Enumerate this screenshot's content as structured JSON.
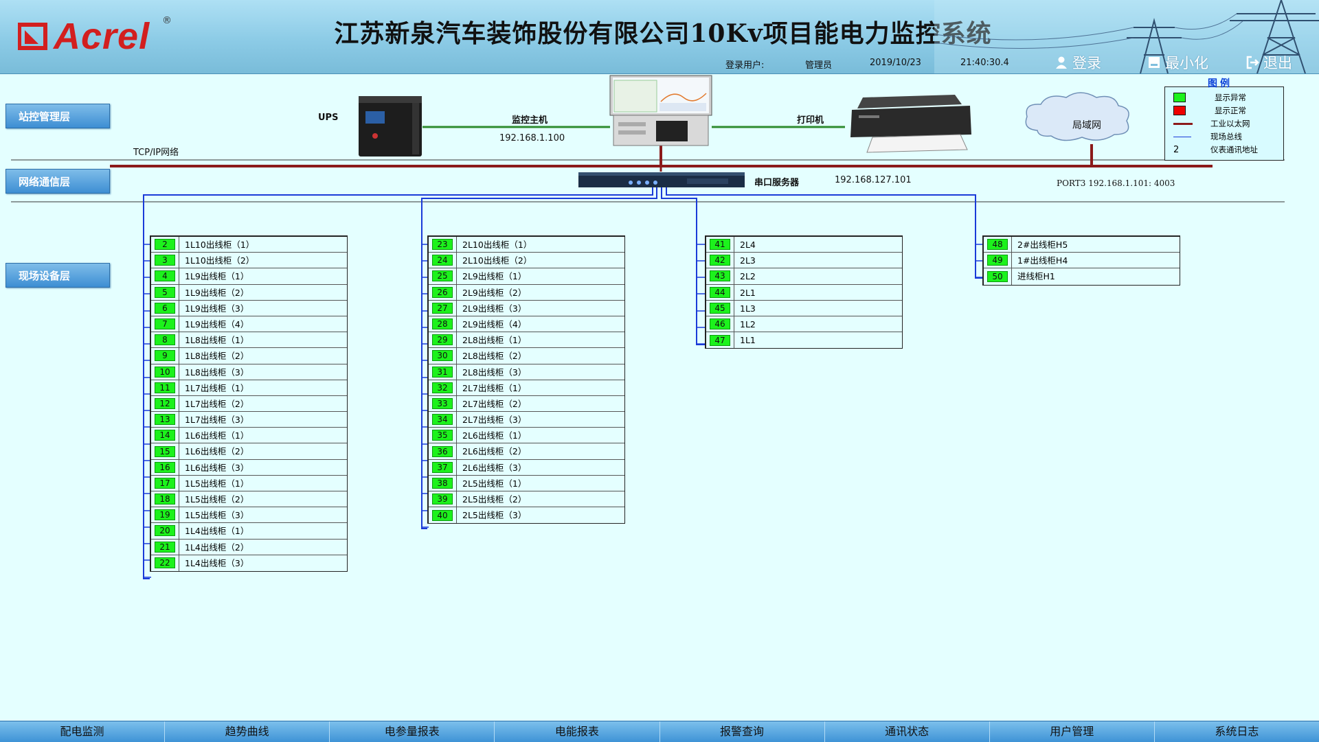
{
  "header": {
    "brand": "Acrel",
    "title": "江苏新泉汽车装饰股份有限公司10Kv项目能电力监控系统",
    "login_label": "登录用户:",
    "user": "管理员",
    "date": "2019/10/23",
    "time": "21:40:30.4",
    "btn_login": "登录",
    "btn_minimize": "最小化",
    "btn_exit": "退出"
  },
  "layers": {
    "station": "站控管理层",
    "network": "网络通信层",
    "field": "现场设备层"
  },
  "topology": {
    "ups": "UPS",
    "host": "监控主机",
    "host_ip": "192.168.1.100",
    "printer": "打印机",
    "lan": "局域网",
    "tcpip": "TCP/IP网络",
    "serial_server": "串口服务器",
    "serial_ip": "192.168.127.101",
    "port_info": "PORT3 192.168.1.101: 4003"
  },
  "legend": {
    "title": "图例",
    "items": [
      {
        "swatch": "green-box",
        "color": "#1cf21c",
        "label": "显示异常"
      },
      {
        "swatch": "red-box",
        "color": "#ee0000",
        "label": "显示正常"
      },
      {
        "swatch": "dark-red-line",
        "color": "#8b1a1a",
        "label": "工业以太网"
      },
      {
        "swatch": "blue-line",
        "color": "#1a3ad8",
        "label": "现场总线"
      },
      {
        "swatch": "number",
        "value": "2",
        "label": "仪表通讯地址"
      }
    ]
  },
  "device_groups": [
    {
      "rows": [
        {
          "addr": "2",
          "name": "1L10出线柜（1）"
        },
        {
          "addr": "3",
          "name": "1L10出线柜（2）"
        },
        {
          "addr": "4",
          "name": "1L9出线柜（1）"
        },
        {
          "addr": "5",
          "name": "1L9出线柜（2）"
        },
        {
          "addr": "6",
          "name": "1L9出线柜（3）"
        },
        {
          "addr": "7",
          "name": "1L9出线柜（4）"
        },
        {
          "addr": "8",
          "name": "1L8出线柜（1）"
        },
        {
          "addr": "9",
          "name": "1L8出线柜（2）"
        },
        {
          "addr": "10",
          "name": "1L8出线柜（3）"
        },
        {
          "addr": "11",
          "name": "1L7出线柜（1）"
        },
        {
          "addr": "12",
          "name": "1L7出线柜（2）"
        },
        {
          "addr": "13",
          "name": "1L7出线柜（3）"
        },
        {
          "addr": "14",
          "name": "1L6出线柜（1）"
        },
        {
          "addr": "15",
          "name": "1L6出线柜（2）"
        },
        {
          "addr": "16",
          "name": "1L6出线柜（3）"
        },
        {
          "addr": "17",
          "name": "1L5出线柜（1）"
        },
        {
          "addr": "18",
          "name": "1L5出线柜（2）"
        },
        {
          "addr": "19",
          "name": "1L5出线柜（3）"
        },
        {
          "addr": "20",
          "name": "1L4出线柜（1）"
        },
        {
          "addr": "21",
          "name": "1L4出线柜（2）"
        },
        {
          "addr": "22",
          "name": "1L4出线柜（3）"
        }
      ]
    },
    {
      "rows": [
        {
          "addr": "23",
          "name": "2L10出线柜（1）"
        },
        {
          "addr": "24",
          "name": "2L10出线柜（2）"
        },
        {
          "addr": "25",
          "name": "2L9出线柜（1）"
        },
        {
          "addr": "26",
          "name": "2L9出线柜（2）"
        },
        {
          "addr": "27",
          "name": "2L9出线柜（3）"
        },
        {
          "addr": "28",
          "name": "2L9出线柜（4）"
        },
        {
          "addr": "29",
          "name": "2L8出线柜（1）"
        },
        {
          "addr": "30",
          "name": "2L8出线柜（2）"
        },
        {
          "addr": "31",
          "name": "2L8出线柜（3）"
        },
        {
          "addr": "32",
          "name": "2L7出线柜（1）"
        },
        {
          "addr": "33",
          "name": "2L7出线柜（2）"
        },
        {
          "addr": "34",
          "name": "2L7出线柜（3）"
        },
        {
          "addr": "35",
          "name": "2L6出线柜（1）"
        },
        {
          "addr": "36",
          "name": "2L6出线柜（2）"
        },
        {
          "addr": "37",
          "name": "2L6出线柜（3）"
        },
        {
          "addr": "38",
          "name": "2L5出线柜（1）"
        },
        {
          "addr": "39",
          "name": "2L5出线柜（2）"
        },
        {
          "addr": "40",
          "name": "2L5出线柜（3）"
        }
      ]
    },
    {
      "rows": [
        {
          "addr": "41",
          "name": "2L4"
        },
        {
          "addr": "42",
          "name": "2L3"
        },
        {
          "addr": "43",
          "name": "2L2"
        },
        {
          "addr": "44",
          "name": "2L1"
        },
        {
          "addr": "45",
          "name": "1L3"
        },
        {
          "addr": "46",
          "name": "1L2"
        },
        {
          "addr": "47",
          "name": "1L1"
        }
      ]
    },
    {
      "rows": [
        {
          "addr": "48",
          "name": "2#出线柜H5"
        },
        {
          "addr": "49",
          "name": "1#出线柜H4"
        },
        {
          "addr": "50",
          "name": "进线柜H1"
        }
      ]
    }
  ],
  "nav": [
    "配电监测",
    "趋势曲线",
    "电参量报表",
    "电能报表",
    "报警查询",
    "通讯状态",
    "用户管理",
    "系统日志"
  ],
  "colors": {
    "background": "#e4ffff",
    "ethernet": "#8b1a1a",
    "fieldbus": "#1a3ad8",
    "comm_ok": "#1cf21c",
    "layer_button": "#3d8ed3"
  }
}
